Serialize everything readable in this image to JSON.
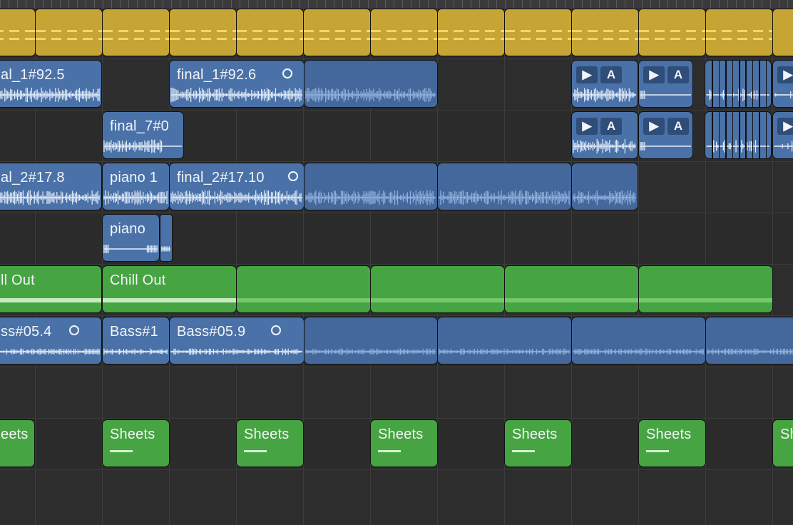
{
  "colors": {
    "background": "#2b2b2b",
    "audio_region": "#4a72a8",
    "midi_region": "#47a442",
    "folder_region": "#c6a534",
    "region_text": "#f2f4f8",
    "waveform": "#dfe9f7"
  },
  "tracks": {
    "folder": {
      "regions": [
        "",
        "",
        "",
        "",
        "",
        "",
        "",
        "",
        "",
        "",
        "",
        ""
      ]
    },
    "vocal_1": {
      "region_a": "al_1#92.5",
      "region_b": "final_1#92.6",
      "quick_sampler_play": "▶",
      "quick_sampler_a": "A"
    },
    "vocal_2": {
      "region_a": "final_7#0"
    },
    "vocal_3": {
      "region_a": "al_2#17.8",
      "region_b": "piano 1",
      "region_c": "final_2#17.10"
    },
    "piano": {
      "region_a": "piano"
    },
    "drummer": {
      "region_a": "ll Out",
      "region_b": "Chill Out"
    },
    "bass": {
      "region_a": "ss#05.4",
      "region_b": "Bass#1",
      "region_c": "Bass#05.9"
    },
    "sheets": {
      "label": "Sheets",
      "label_partial_left": "eets",
      "label_partial_right": "Sh"
    }
  }
}
